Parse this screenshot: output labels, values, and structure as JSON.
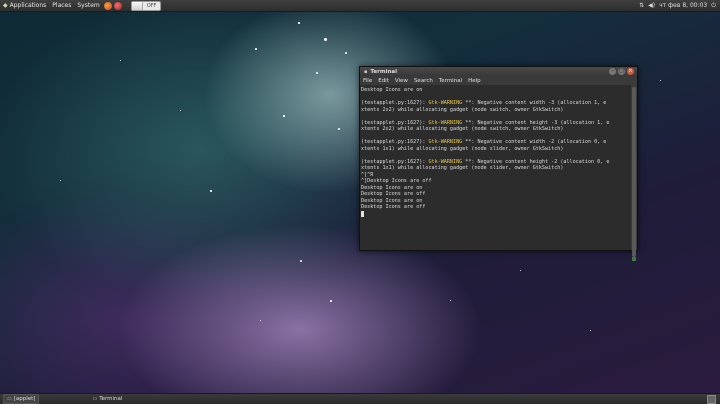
{
  "top_panel": {
    "applications": "Applications",
    "places": "Places",
    "system": "System",
    "toggle_label": "OFF",
    "clock": "чт фев 8, 00:03"
  },
  "terminal": {
    "title": "Terminal",
    "menu": [
      "File",
      "Edit",
      "View",
      "Search",
      "Terminal",
      "Help"
    ],
    "lines": [
      {
        "pre": "Desktop Icons are on",
        "warn": "",
        "post": ""
      },
      {
        "pre": "",
        "warn": "",
        "post": ""
      },
      {
        "pre": "(testapplet.py:1627): ",
        "warn": "Gtk-WARNING",
        "post": " **: Negative content width -3 (allocation 1, e"
      },
      {
        "pre": "xtents 2x2) while allocating gadget (node switch, owner GtkSwitch)",
        "warn": "",
        "post": ""
      },
      {
        "pre": "",
        "warn": "",
        "post": ""
      },
      {
        "pre": "(testapplet.py:1627): ",
        "warn": "Gtk-WARNING",
        "post": " **: Negative content height -3 (allocation 1, e"
      },
      {
        "pre": "xtents 2x2) while allocating gadget (node switch, owner GtkSwitch)",
        "warn": "",
        "post": ""
      },
      {
        "pre": "",
        "warn": "",
        "post": ""
      },
      {
        "pre": "(testapplet.py:1627): ",
        "warn": "Gtk-WARNING",
        "post": " **: Negative content width -2 (allocation 0, e"
      },
      {
        "pre": "xtents 1x1) while allocating gadget (node slider, owner GtkSwitch)",
        "warn": "",
        "post": ""
      },
      {
        "pre": "",
        "warn": "",
        "post": ""
      },
      {
        "pre": "(testapplet.py:1627): ",
        "warn": "Gtk-WARNING",
        "post": " **: Negative content height -2 (allocation 0, e"
      },
      {
        "pre": "xtents 1x1) while allocating gadget (node slider, owner GtkSwitch)",
        "warn": "",
        "post": ""
      },
      {
        "pre": "^[^R",
        "warn": "",
        "post": ""
      },
      {
        "pre": "^[Desktop Icons are off",
        "warn": "",
        "post": ""
      },
      {
        "pre": "Desktop Icons are on",
        "warn": "",
        "post": ""
      },
      {
        "pre": "Desktop Icons are off",
        "warn": "",
        "post": ""
      },
      {
        "pre": "Desktop Icons are on",
        "warn": "",
        "post": ""
      },
      {
        "pre": "Desktop Icons are off",
        "warn": "",
        "post": ""
      }
    ]
  },
  "bottom_panel": {
    "task_applet": "[applet]",
    "task_terminal": "Terminal"
  }
}
